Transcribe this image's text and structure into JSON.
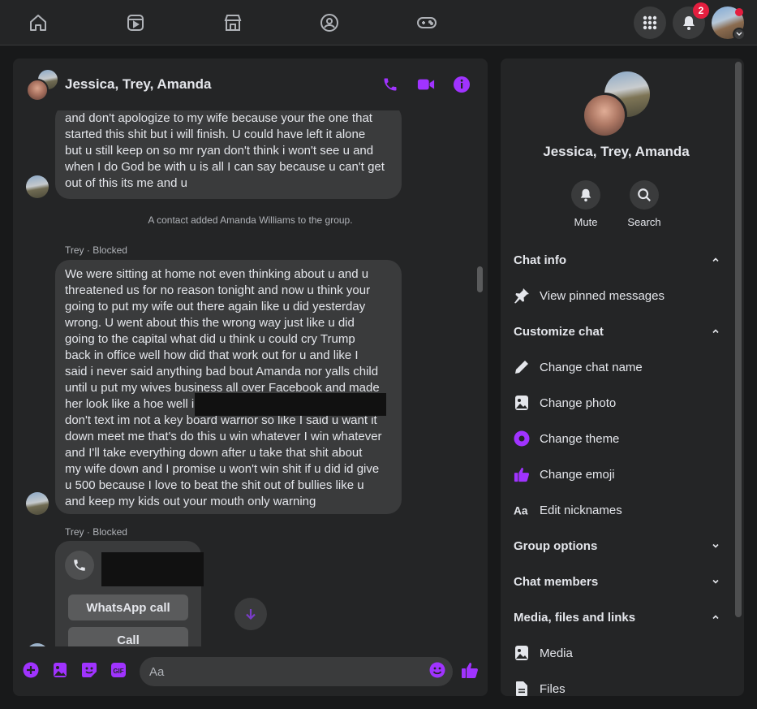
{
  "nav": {
    "notifications_count": "2"
  },
  "chat": {
    "title": "Jessica, Trey, Amanda",
    "messages": {
      "msg1": "and don't apologize to my wife because your the one that\nstarted this shit but i will finish. U could have left it alone\nbut u still keep on so mr ryan don't think i won't see u and\nwhen I do God be with u is all I can say because u can't get\nout of this its me and u",
      "system": "A contact added Amanda Williams to the group.",
      "sender1": "Trey · Blocked",
      "msg2": "We were sitting at home not even thinking about u and u\nthreatened us for no reason tonight and now u think your\ngoing to put my wife out there again like u did yesterday\nwrong. U went about this the wrong way just like u did\ngoing to the capital what did u think u could cry Trump\nback in office well how did that work out for u and like I\nsaid i never said anything bad bout Amanda nor yalls child\nuntil u put my wives business all over Facebook and made\nher look like a hoe well i\ndon't text im not a key board warrior so like I said u want it\ndown meet me that's do this u win whatever I win whatever\nand I'll take everything down after u take that shit about\nmy wife down and I promise u won't win shit if u did id give\nu 500  because I love to beat the shit out of bullies like u\nand keep my kids out your mouth only warning",
      "sender2": "Trey · Blocked",
      "call_button_1": "WhatsApp call",
      "call_button_2": "Call"
    },
    "composer_placeholder": "Aa"
  },
  "info": {
    "name": "Jessica, Trey, Amanda",
    "actions": {
      "mute": "Mute",
      "search": "Search"
    },
    "sections": {
      "chat_info": "Chat info",
      "view_pinned": "View pinned messages",
      "customize": "Customize chat",
      "change_name": "Change chat name",
      "change_photo": "Change photo",
      "change_theme": "Change theme",
      "change_emoji": "Change emoji",
      "edit_nicknames": "Edit nicknames",
      "group_options": "Group options",
      "chat_members": "Chat members",
      "media_files": "Media, files and links",
      "media": "Media",
      "files": "Files"
    }
  },
  "colors": {
    "accent": "#a033ff",
    "badge": "#e41e3f",
    "background": "#18191a",
    "panel": "#242526",
    "bubble": "#3a3b3c"
  }
}
